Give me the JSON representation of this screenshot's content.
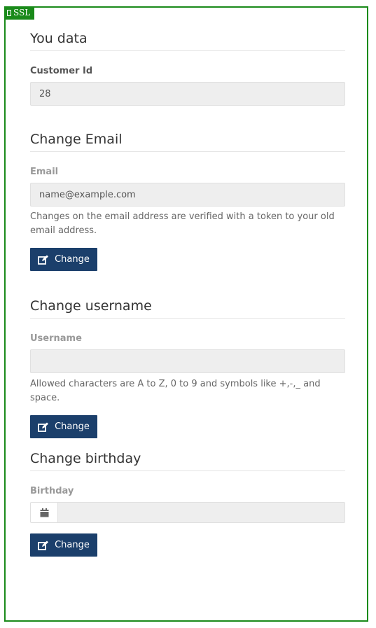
{
  "ssl_badge": {
    "label": "SSL",
    "icon": "lock-icon"
  },
  "sections": {
    "your_data": {
      "title": "You data",
      "customer_id_label": "Customer Id",
      "customer_id_value": "28"
    },
    "change_email": {
      "title": "Change Email",
      "email_label": "Email",
      "email_value": "name@example.com",
      "help": "Changes on the email address are verified with a token to your old email address.",
      "button_label": "Change",
      "button_icon": "edit-icon"
    },
    "change_username": {
      "title": "Change username",
      "username_label": "Username",
      "username_value": "",
      "help": "Allowed characters are A to Z, 0 to 9 and symbols like +,-,_ and space.",
      "button_label": "Change",
      "button_icon": "edit-icon"
    },
    "change_birthday": {
      "title": "Change birthday",
      "birthday_label": "Birthday",
      "birthday_value": "",
      "calendar_icon": "calendar-icon",
      "button_label": "Change",
      "button_icon": "edit-icon"
    }
  },
  "colors": {
    "frame_border": "#1a8a1a",
    "button_bg": "#1b3f6b",
    "input_bg": "#eeeeee"
  }
}
